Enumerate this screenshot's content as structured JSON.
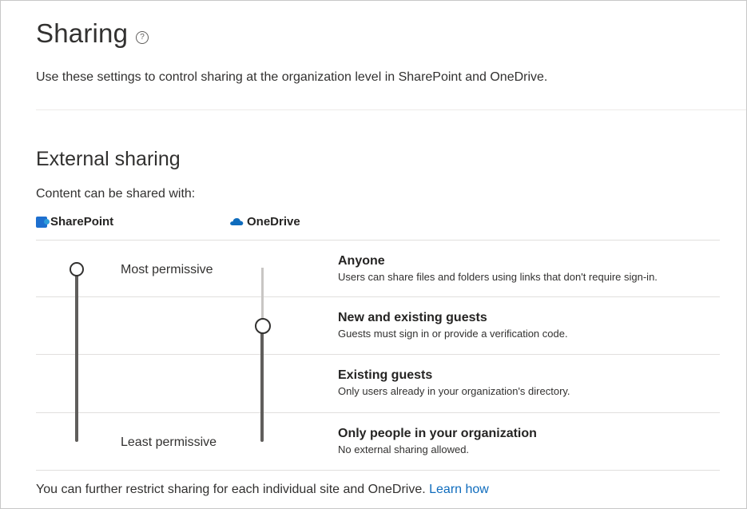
{
  "header": {
    "title": "Sharing",
    "help_icon_glyph": "?",
    "subtitle": "Use these settings to control sharing at the organization level in SharePoint and OneDrive."
  },
  "external_sharing": {
    "title": "External sharing",
    "content_label": "Content can be shared with:",
    "apps": {
      "sharepoint": {
        "label": "SharePoint",
        "icon": "sharepoint-icon",
        "color": "#1e6fcf"
      },
      "onedrive": {
        "label": "OneDrive",
        "icon": "onedrive-cloud-icon",
        "color": "#0f6cbd"
      }
    },
    "most_permissive": "Most permissive",
    "least_permissive": "Least permissive",
    "levels": [
      {
        "title": "Anyone",
        "description": "Users can share files and folders using links that don't require sign-in."
      },
      {
        "title": "New and existing guests",
        "description": "Guests must sign in or provide a verification code."
      },
      {
        "title": "Existing guests",
        "description": "Only users already in your organization's directory."
      },
      {
        "title": "Only people in your organization",
        "description": "No external sharing allowed."
      }
    ],
    "sharepoint_selected_level": "Anyone",
    "onedrive_selected_level": "New and existing guests"
  },
  "footer": {
    "text": "You can further restrict sharing for each individual site and OneDrive.",
    "link": "Learn how"
  },
  "colors": {
    "link": "#0f6cbd",
    "slider": "#605e5c"
  }
}
